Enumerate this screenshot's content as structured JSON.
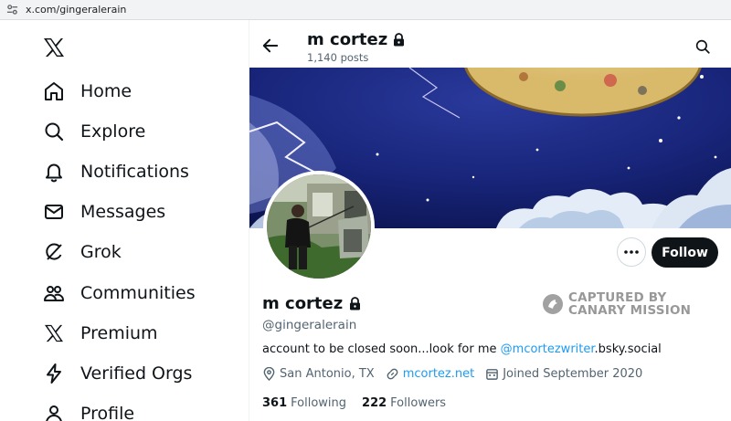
{
  "browser": {
    "url": "x.com/gingeralerain"
  },
  "sidebar": {
    "items": [
      {
        "label": "Home"
      },
      {
        "label": "Explore"
      },
      {
        "label": "Notifications"
      },
      {
        "label": "Messages"
      },
      {
        "label": "Grok"
      },
      {
        "label": "Communities"
      },
      {
        "label": "Premium"
      },
      {
        "label": "Verified Orgs"
      },
      {
        "label": "Profile"
      }
    ]
  },
  "header": {
    "name": "m cortez",
    "posts": "1,140 posts"
  },
  "profile": {
    "name": "m cortez",
    "handle": "@gingeralerain",
    "follow_label": "Follow",
    "bio_prefix": "account to be closed soon...look for me ",
    "bio_mention": "@mcortezwriter",
    "bio_suffix": ".bsky.social",
    "location": "San Antonio, TX",
    "website": "mcortez.net",
    "joined": "Joined September 2020",
    "following_count": "361",
    "following_label": "Following",
    "followers_count": "222",
    "followers_label": "Followers"
  },
  "watermark": {
    "line1": "CAPTURED BY",
    "line2": "CANARY MISSION"
  },
  "colors": {
    "accent": "#1d9bf0",
    "text": "#0f1419",
    "muted": "#536471"
  }
}
